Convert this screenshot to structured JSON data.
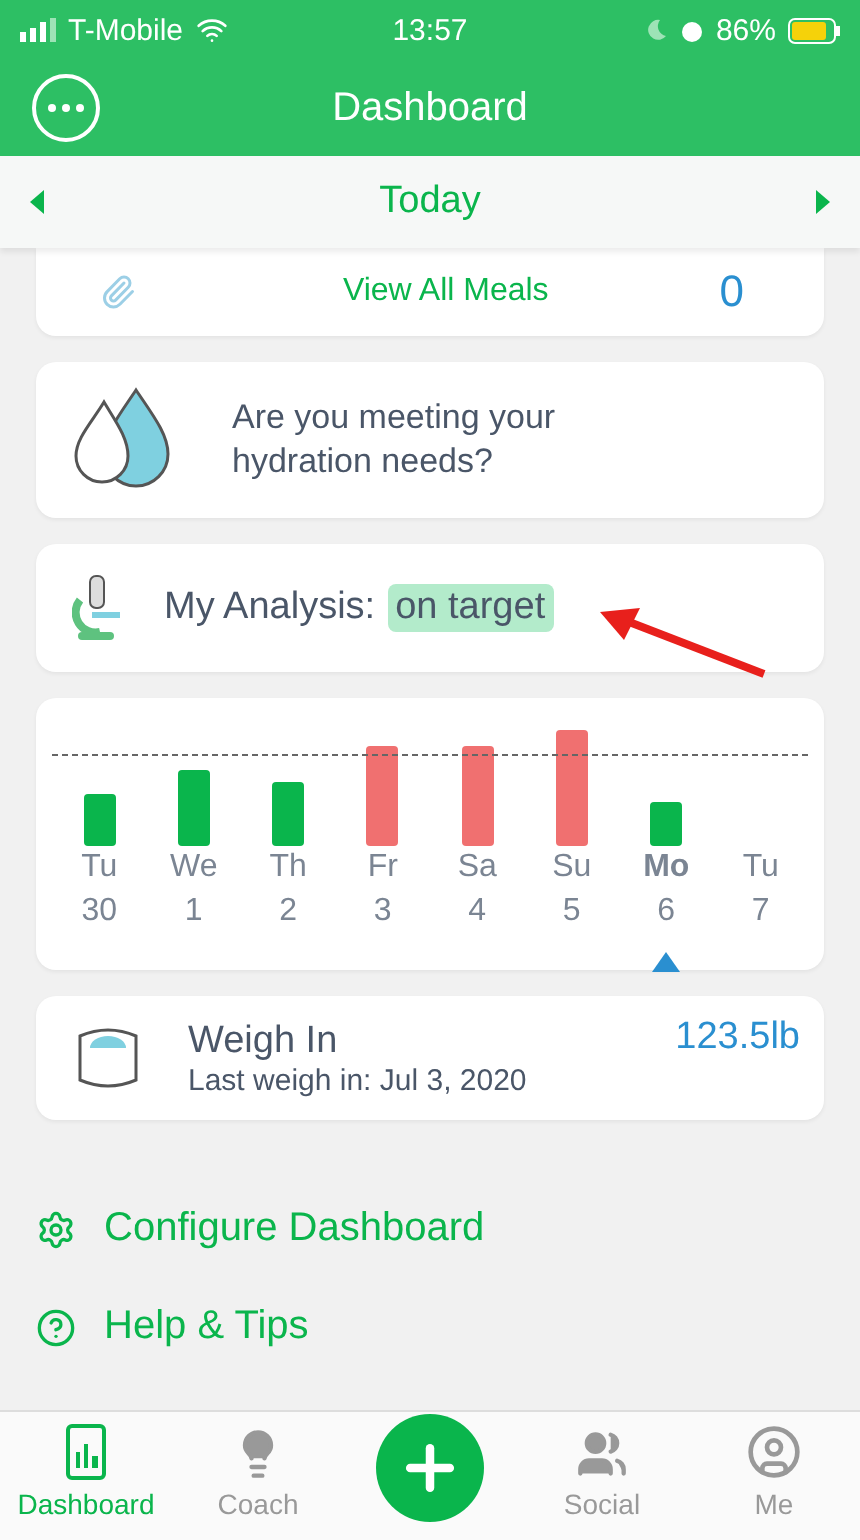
{
  "status_bar": {
    "carrier": "T-Mobile",
    "time": "13:57",
    "battery": "86%"
  },
  "header": {
    "title": "Dashboard"
  },
  "date_bar": {
    "label": "Today"
  },
  "meals": {
    "label": "View All Meals",
    "count": "0"
  },
  "hydration": {
    "text": "Are you meeting your hydration needs?"
  },
  "analysis": {
    "label": "My Analysis:",
    "status": "on target"
  },
  "week": [
    {
      "day": "Tu",
      "date": "30",
      "color": "#0ab54c",
      "selected": false
    },
    {
      "day": "We",
      "date": "1",
      "color": "#0ab54c",
      "selected": false
    },
    {
      "day": "Th",
      "date": "2",
      "color": "#0ab54c",
      "selected": false
    },
    {
      "day": "Fr",
      "date": "3",
      "color": "#f07070",
      "selected": false
    },
    {
      "day": "Sa",
      "date": "4",
      "color": "#f07070",
      "selected": false
    },
    {
      "day": "Su",
      "date": "5",
      "color": "#f07070",
      "selected": false
    },
    {
      "day": "Mo",
      "date": "6",
      "color": "#0ab54c",
      "selected": true
    },
    {
      "day": "Tu",
      "date": "7",
      "selected": false
    }
  ],
  "weigh_in": {
    "title": "Weigh In",
    "subtitle": "Last weigh in: Jul 3, 2020",
    "value": "123.5lb"
  },
  "links": [
    {
      "kind": "settings",
      "label": "Configure Dashboard"
    },
    {
      "kind": "help",
      "label": "Help & Tips"
    }
  ],
  "tabs": [
    {
      "kind": "dashboard",
      "label": "Dashboard",
      "selected": true
    },
    {
      "kind": "coach",
      "label": "Coach",
      "selected": false
    },
    {
      "kind": "add"
    },
    {
      "kind": "social",
      "label": "Social",
      "selected": false
    },
    {
      "kind": "me",
      "label": "Me",
      "selected": false
    }
  ]
}
